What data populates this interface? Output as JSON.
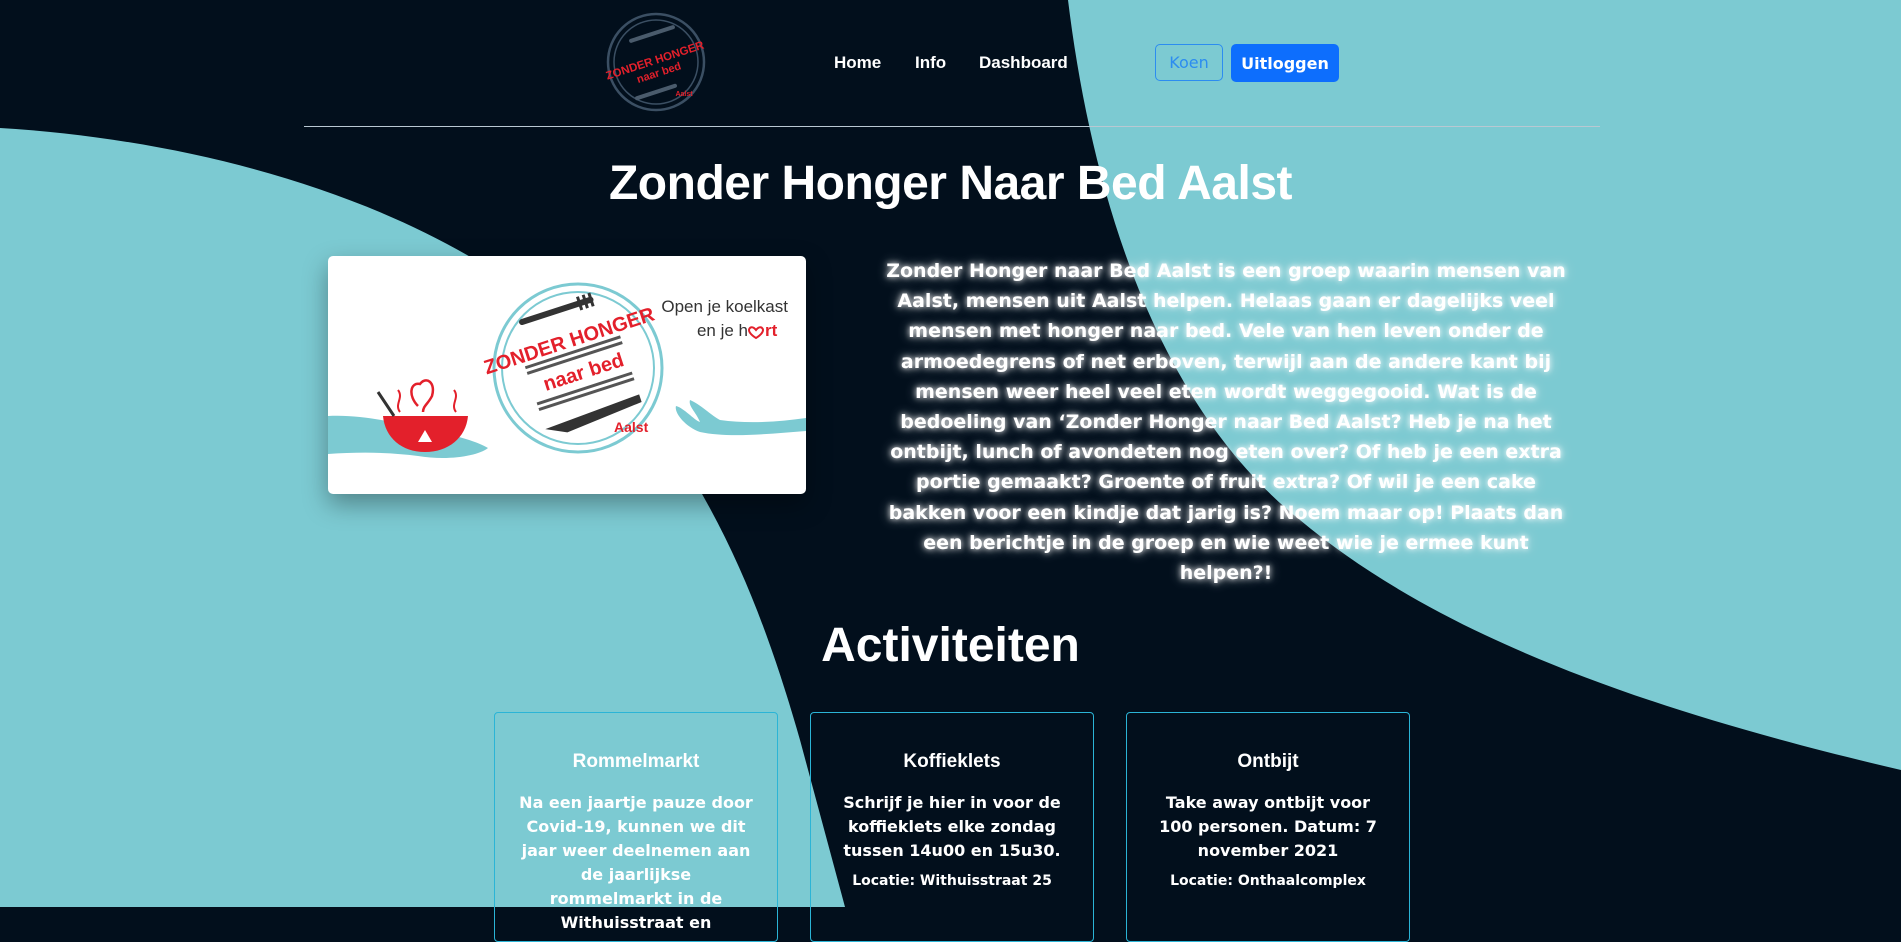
{
  "nav": {
    "logo_text": [
      "ZONDER HONGER",
      "naar bed",
      "Aalst"
    ],
    "links": [
      "Home",
      "Info",
      "Dashboard"
    ],
    "user_label": "Koen",
    "logout_label": "Uitloggen"
  },
  "hero": {
    "title": "Zonder Honger Naar Bed Aalst",
    "banner": {
      "logo_lines": [
        "ZONDER HONGER",
        "naar bed",
        "Aalst"
      ],
      "tagline_1": "Open je koelkast",
      "tagline_2": "en je h",
      "tagline_2b": "rt"
    },
    "intro": "Zonder Honger naar Bed Aalst is een groep waarin mensen van Aalst, mensen uit Aalst helpen. Helaas gaan er dagelijks veel mensen met honger naar bed. Vele van hen leven onder de armoedegrens of net erboven, terwijl aan de andere kant bij mensen weer heel veel eten wordt weggegooid. Wat is de bedoeling van ‘Zonder Honger naar Bed Aalst? Heb je na het ontbijt, lunch of avondeten nog eten over? Of heb je een extra portie gemaakt? Groente of fruit extra? Of wil je een cake bakken voor een kindje dat jarig is? Noem maar op! Plaats dan een berichtje in de groep en wie weet wie je ermee kunt helpen?!"
  },
  "activities": {
    "title": "Activiteiten",
    "cards": [
      {
        "title": "Rommelmarkt",
        "text": "Na een jaartje pauze door Covid-19, kunnen we dit jaar weer deelnemen aan de jaarlijkse rommelmarkt in de Withuisstraat en",
        "location": ""
      },
      {
        "title": "Koffieklets",
        "text": "Schrijf je hier in voor de koffieklets elke zondag tussen 14u00 en 15u30.",
        "location": "Locatie: Withuisstraat 25"
      },
      {
        "title": "Ontbijt",
        "text": "Take away ontbijt voor 100 personen. Datum: 7 november 2021",
        "location": "Locatie: Onthaalcomplex"
      }
    ]
  },
  "colors": {
    "dark": "#020f1c",
    "teal": "#7ccad2",
    "primary": "#0d6efd",
    "red": "#e3202b"
  }
}
